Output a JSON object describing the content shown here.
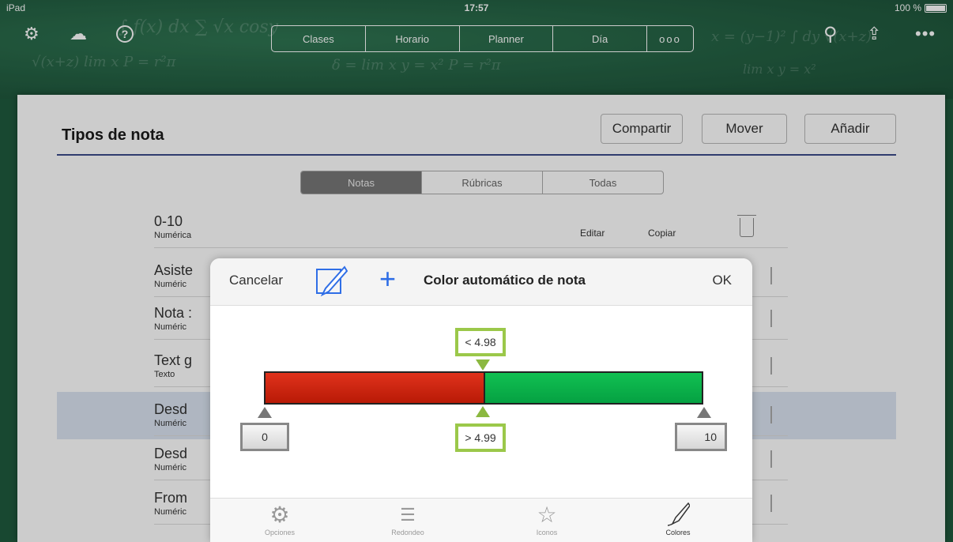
{
  "status": {
    "device": "iPad",
    "time": "17:57",
    "battery": "100 %"
  },
  "nav": {
    "segments": [
      "Clases",
      "Horario",
      "Planner",
      "Día",
      "ooo"
    ],
    "icons": [
      "gear-icon",
      "cloud-upload-icon",
      "help-icon",
      "search-icon",
      "share-icon",
      "more-icon"
    ]
  },
  "header": {
    "title": "Tipos de nota",
    "share_label": "Compartir",
    "move_label": "Mover",
    "add_label": "Añadir"
  },
  "filter": {
    "options": [
      "Notas",
      "Rúbricas",
      "Todas"
    ],
    "selected": "Notas"
  },
  "rows": [
    {
      "name": "0-10",
      "type": "Numérica"
    },
    {
      "name": "Asiste",
      "type": "Numéric"
    },
    {
      "name": "Nota :",
      "type": "Numéric"
    },
    {
      "name": "Text g",
      "type": "Texto"
    },
    {
      "name": "Desd",
      "type": "Numéric"
    },
    {
      "name": "Desd",
      "type": "Numéric"
    },
    {
      "name": "From",
      "type": "Numéric"
    }
  ],
  "row_actions": {
    "edit": "Editar",
    "copy": "Copiar"
  },
  "popover": {
    "cancel": "Cancelar",
    "title": "Color automático de nota",
    "ok": "OK",
    "scale": {
      "min": "0",
      "max": "10",
      "upper_threshold": "< 4.98",
      "lower_threshold": "> 4.99",
      "colors": {
        "low": "#d32a12",
        "high": "#0cb24b"
      }
    },
    "tabs": [
      {
        "label": "Opciones",
        "icon": "gear-icon"
      },
      {
        "label": "Redondeo",
        "icon": "rounding-icon"
      },
      {
        "label": "Iconos",
        "icon": "star-icon"
      },
      {
        "label": "Colores",
        "icon": "brush-icon"
      }
    ],
    "selected_tab": "Colores"
  }
}
